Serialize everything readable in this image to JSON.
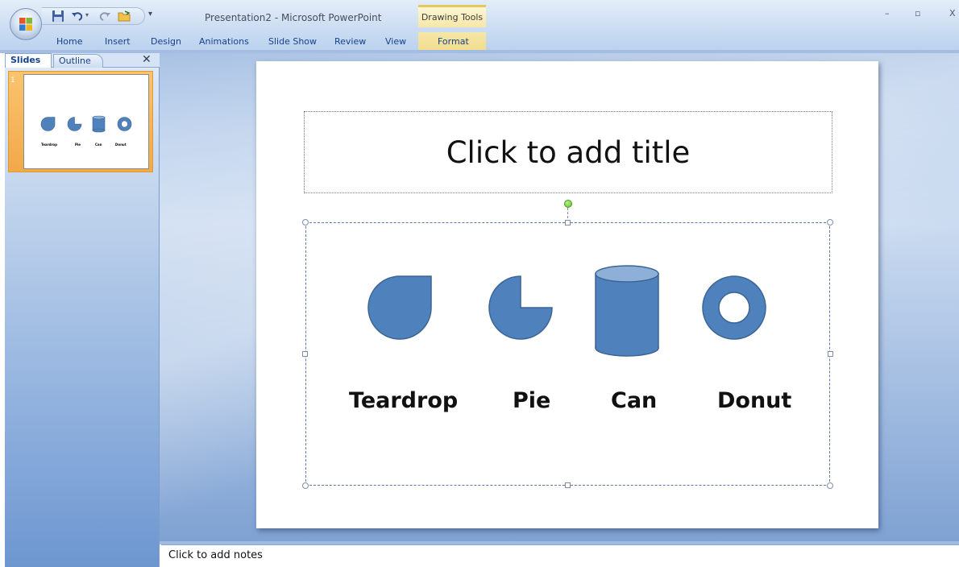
{
  "window": {
    "title": "Presentation2 - Microsoft PowerPoint",
    "context_tools_label": "Drawing Tools",
    "minimize": "–",
    "restore": "▫",
    "close": "X"
  },
  "quick_access": {
    "customize_glyph": "▾"
  },
  "ribbon": {
    "tabs": [
      "Home",
      "Insert",
      "Design",
      "Animations",
      "Slide Show",
      "Review",
      "View"
    ],
    "context_tab": "Format"
  },
  "left_pane": {
    "tab_slides": "Slides",
    "tab_outline": "Outline",
    "close_glyph": "✕",
    "slide_number": "1",
    "thumb_labels": [
      "Teardrop",
      "Pie",
      "Can",
      "Donut"
    ]
  },
  "slide": {
    "title_placeholder": "Click to add title",
    "shapes": [
      {
        "name": "Teardrop",
        "label": "Teardrop"
      },
      {
        "name": "Pie",
        "label": "Pie"
      },
      {
        "name": "Can",
        "label": "Can"
      },
      {
        "name": "Donut",
        "label": "Donut"
      }
    ],
    "shape_fill": "#4f81bd",
    "shape_stroke": "#3a6494"
  },
  "notes": {
    "placeholder": "Click to add notes"
  },
  "colors": {
    "ribbon_text": "#15428b",
    "slide_thumb_highlight": "#f2a94a",
    "context_tab": "#f6e7a8"
  }
}
